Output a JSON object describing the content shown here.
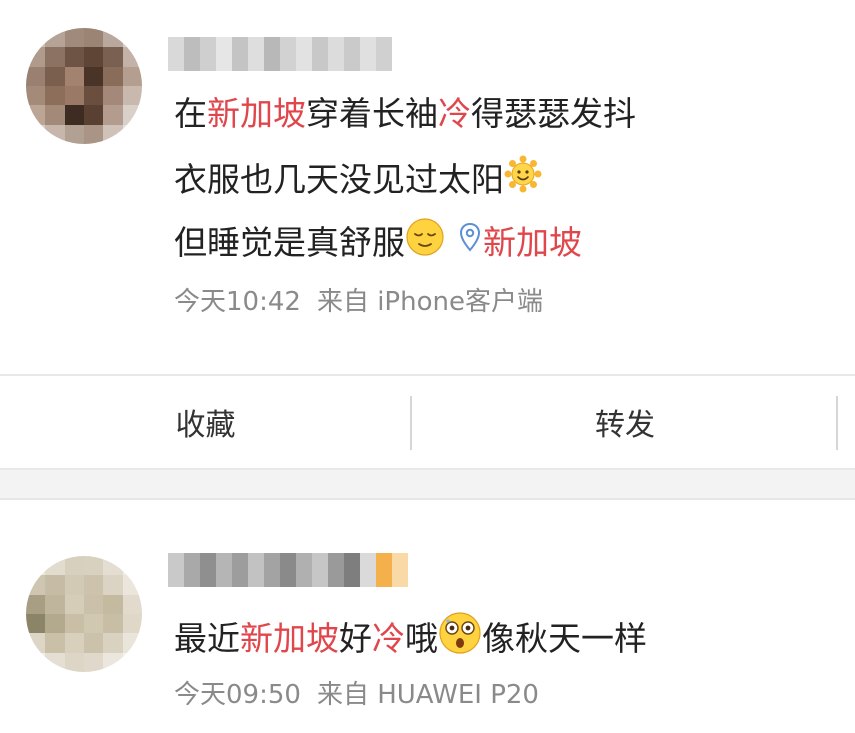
{
  "posts": [
    {
      "username": "",
      "content_lines": [
        [
          {
            "text": "在",
            "highlight": false
          },
          {
            "text": "新加坡",
            "highlight": true
          },
          {
            "text": "穿着长袖",
            "highlight": false
          },
          {
            "text": "冷",
            "highlight": true
          },
          {
            "text": "得瑟瑟发抖",
            "highlight": false
          }
        ],
        [
          {
            "text": "衣服也几天没见过太阳",
            "highlight": false
          },
          {
            "emoji": "sun-face-emoji"
          }
        ],
        [
          {
            "text": "但睡觉是真舒服",
            "highlight": false
          },
          {
            "emoji": "relieved-face-emoji"
          }
        ]
      ],
      "location": "新加坡",
      "time": "今天10:42",
      "source": "来自 iPhone客户端"
    },
    {
      "username": "",
      "content_lines": [
        [
          {
            "text": "最近",
            "highlight": false
          },
          {
            "text": "新加坡",
            "highlight": true
          },
          {
            "text": "好",
            "highlight": false
          },
          {
            "text": "冷",
            "highlight": true
          },
          {
            "text": "哦",
            "highlight": false
          },
          {
            "emoji": "astonished-face-emoji"
          },
          {
            "text": "像秋天一样",
            "highlight": false
          }
        ]
      ],
      "time": "今天09:50",
      "source": "来自 HUAWEI P20"
    }
  ],
  "actions": {
    "favorite_label": "收藏",
    "repost_label": "转发"
  },
  "colors": {
    "highlight": "#e0474c",
    "meta_text": "#8a8a8a",
    "location_pin": "#5b8fd6",
    "emoji_yellow": "#f7c948"
  }
}
